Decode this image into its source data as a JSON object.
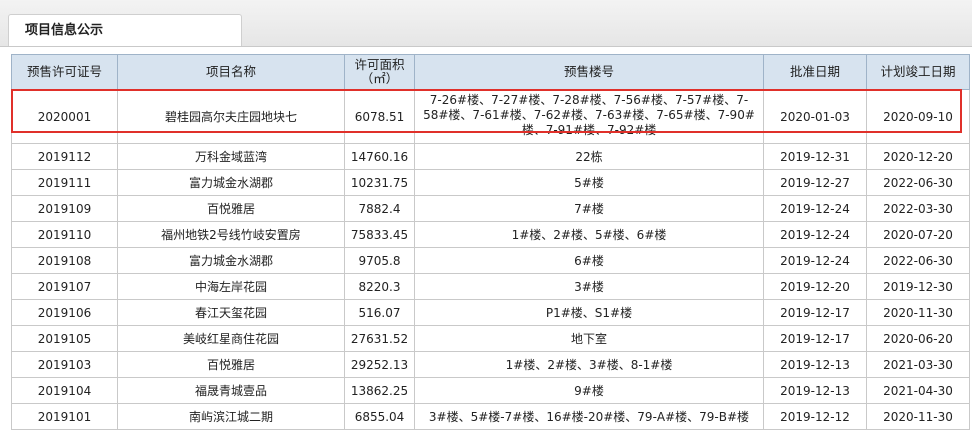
{
  "tab": {
    "label": "项目信息公示"
  },
  "table": {
    "headers": [
      "预售许可证号",
      "项目名称",
      "许可面积（㎡）",
      "预售楼号",
      "批准日期",
      "计划竣工日期"
    ],
    "rows": [
      [
        "2020001",
        "碧桂园高尔夫庄园地块七",
        "6078.51",
        "7-26#楼、7-27#楼、7-28#楼、7-56#楼、7-57#楼、7-58#楼、7-61#楼、7-62#楼、7-63#楼、7-65#楼、7-90#楼、7-91#楼、7-92#楼",
        "2020-01-03",
        "2020-09-10"
      ],
      [
        "2019112",
        "万科金域蓝湾",
        "14760.16",
        "22栋",
        "2019-12-31",
        "2020-12-20"
      ],
      [
        "2019111",
        "富力城金水湖郡",
        "10231.75",
        "5#楼",
        "2019-12-27",
        "2022-06-30"
      ],
      [
        "2019109",
        "百悦雅居",
        "7882.4",
        "7#楼",
        "2019-12-24",
        "2022-03-30"
      ],
      [
        "2019110",
        "福州地铁2号线竹岐安置房",
        "75833.45",
        "1#楼、2#楼、5#楼、6#楼",
        "2019-12-24",
        "2020-07-20"
      ],
      [
        "2019108",
        "富力城金水湖郡",
        "9705.8",
        "6#楼",
        "2019-12-24",
        "2022-06-30"
      ],
      [
        "2019107",
        "中海左岸花园",
        "8220.3",
        "3#楼",
        "2019-12-20",
        "2019-12-30"
      ],
      [
        "2019106",
        "春江天玺花园",
        "516.07",
        "P1#楼、S1#楼",
        "2019-12-17",
        "2020-11-30"
      ],
      [
        "2019105",
        "美岐红星商住花园",
        "27631.52",
        "地下室",
        "2019-12-17",
        "2020-06-20"
      ],
      [
        "2019103",
        "百悦雅居",
        "29252.13",
        "1#楼、2#楼、3#楼、8-1#楼",
        "2019-12-13",
        "2021-03-30"
      ],
      [
        "2019104",
        "福晟青城壹品",
        "13862.25",
        "9#楼",
        "2019-12-13",
        "2021-04-30"
      ],
      [
        "2019101",
        "南屿滨江城二期",
        "6855.04",
        "3#楼、5#楼-7#楼、16#楼-20#楼、79-A#楼、79-B#楼",
        "2019-12-12",
        "2020-11-30"
      ]
    ]
  },
  "colors": {
    "header_bg": "#d7e3ef",
    "highlight_border": "#e0302a"
  }
}
